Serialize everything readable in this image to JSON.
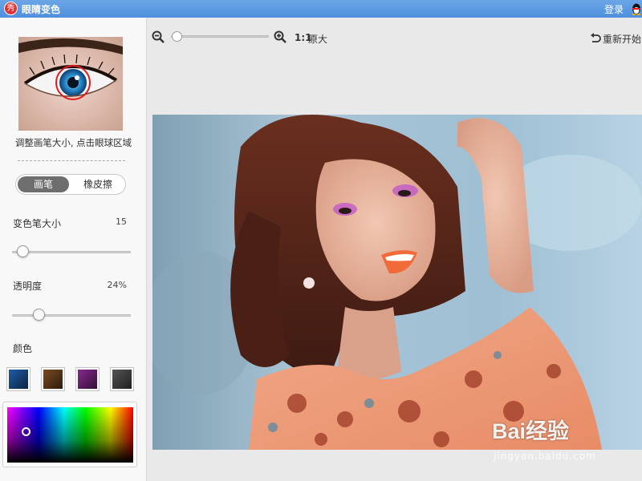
{
  "titlebar": {
    "logo_char": "秀",
    "title": "眼睛变色",
    "login_label": "登录"
  },
  "left_panel": {
    "hint": "调整画笔大小, 点击眼球区域",
    "mode": {
      "brush_label": "画笔",
      "eraser_label": "橡皮擦",
      "active": "brush"
    },
    "brush_size": {
      "label": "变色笔大小",
      "value": "15"
    },
    "opacity": {
      "label": "透明度",
      "value": "24%"
    },
    "color": {
      "label": "颜色",
      "swatches": [
        "#1f5da8",
        "#7a4a23",
        "#862a8e",
        "#555555"
      ]
    }
  },
  "toolbar": {
    "ratio_label": "1:1",
    "original_label": "原大",
    "restart_label": "重新开始"
  },
  "watermark": {
    "brand": "Bai经验",
    "url": "jingyan.baidu.com"
  }
}
